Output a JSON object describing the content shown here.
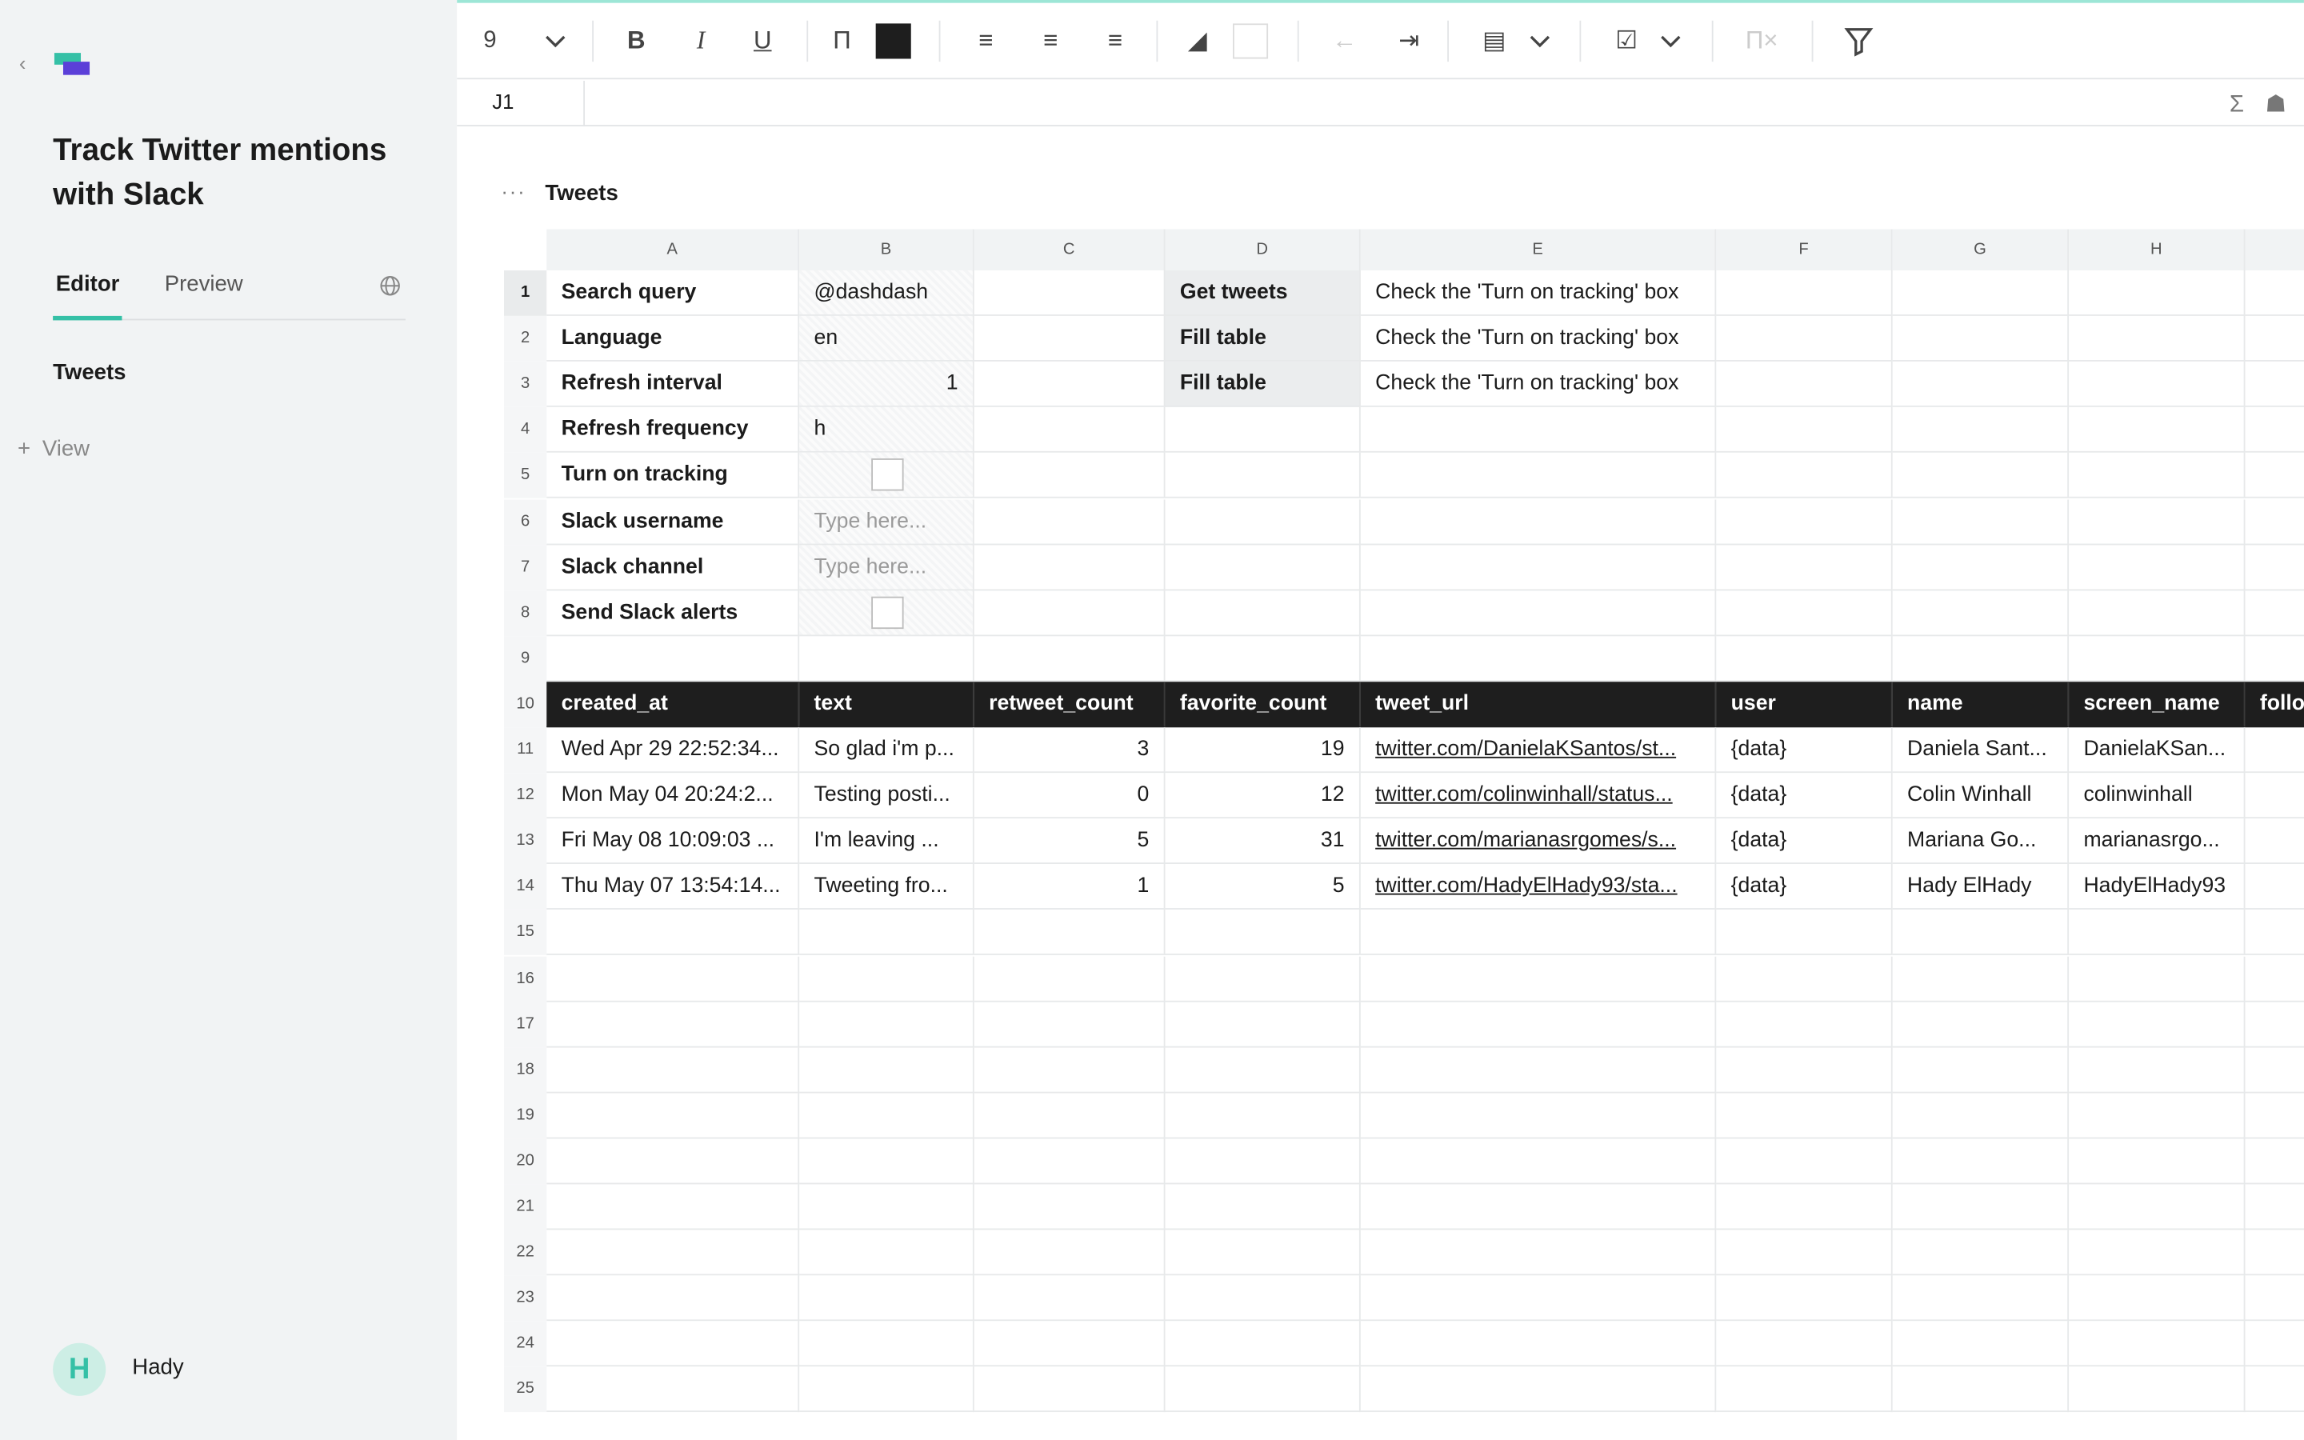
{
  "sidebar": {
    "title": "Track Twitter mentions with Slack",
    "tabs": {
      "editor": "Editor",
      "preview": "Preview"
    },
    "sheets": [
      "Tweets"
    ],
    "add_view": "View",
    "user": {
      "initial": "H",
      "name": "Hady"
    }
  },
  "toolbar": {
    "font_size": "9",
    "text_color": "#1e1e1e"
  },
  "formula_bar": {
    "cell_ref": "J1"
  },
  "sheet": {
    "title": "Tweets"
  },
  "columns": [
    "A",
    "B",
    "C",
    "D",
    "E",
    "F",
    "G",
    "H"
  ],
  "rows": [
    "1",
    "2",
    "3",
    "4",
    "5",
    "6",
    "7",
    "8",
    "9",
    "10",
    "11",
    "12",
    "13",
    "14",
    "15",
    "16",
    "17",
    "18",
    "19",
    "20",
    "21",
    "22",
    "23",
    "24",
    "25"
  ],
  "params": [
    {
      "label": "Search query",
      "value": "@dashdash"
    },
    {
      "label": "Language",
      "value": "en"
    },
    {
      "label": "Refresh interval",
      "value": "1"
    },
    {
      "label": "Refresh frequency",
      "value": "h"
    },
    {
      "label": "Turn on tracking",
      "value": ""
    },
    {
      "label": "Slack username",
      "value": "Type here..."
    },
    {
      "label": "Slack channel",
      "value": "Type here..."
    },
    {
      "label": "Send Slack alerts",
      "value": ""
    }
  ],
  "actions": [
    {
      "label": "Get tweets",
      "status": "Check the 'Turn on tracking' box"
    },
    {
      "label": "Fill table",
      "status": "Check the 'Turn on tracking' box"
    },
    {
      "label": "Fill table",
      "status": "Check the 'Turn on tracking' box"
    }
  ],
  "table": {
    "headers": [
      "created_at",
      "text",
      "retweet_count",
      "favorite_count",
      "tweet_url",
      "user",
      "name",
      "screen_name",
      "follo"
    ],
    "rows": [
      [
        "Wed Apr 29 22:52:34...",
        "So glad i'm p...",
        "3",
        "19",
        "twitter.com/DanielaKSantos/st...",
        "{data}",
        "Daniela Sant...",
        "DanielaKSan..."
      ],
      [
        "Mon May 04 20:24:2...",
        "Testing posti...",
        "0",
        "12",
        "twitter.com/colinwinhall/status...",
        "{data}",
        "Colin Winhall",
        "colinwinhall"
      ],
      [
        "Fri May 08 10:09:03 ...",
        "I'm leaving ...",
        "5",
        "31",
        "twitter.com/marianasrgomes/s...",
        "{data}",
        "Mariana Go...",
        "marianasrgo..."
      ],
      [
        "Thu May 07 13:54:14...",
        "Tweeting fro...",
        "1",
        "5",
        "twitter.com/HadyElHady93/sta...",
        "{data}",
        "Hady ElHady",
        "HadyElHady93"
      ]
    ]
  }
}
